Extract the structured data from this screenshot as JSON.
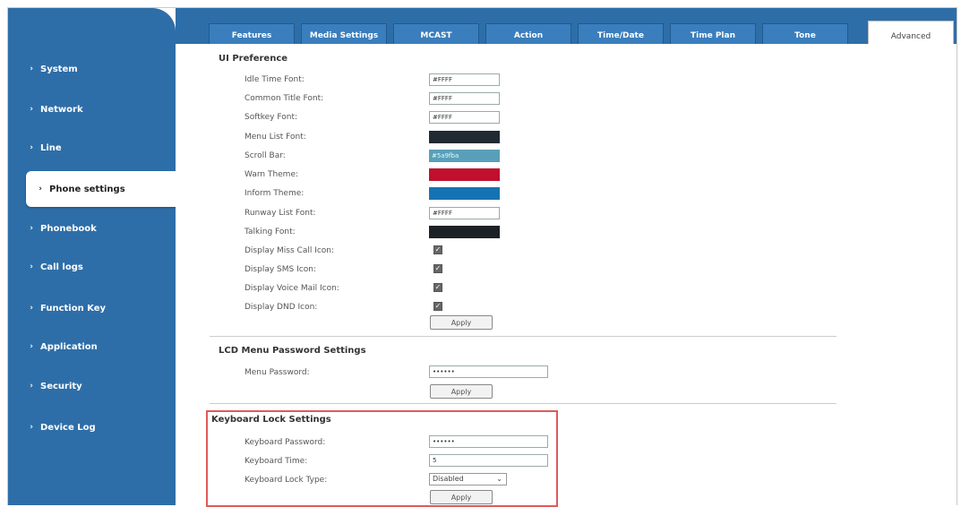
{
  "sidebar": {
    "items": [
      {
        "label": "System"
      },
      {
        "label": "Network"
      },
      {
        "label": "Line"
      },
      {
        "label": "Phone settings"
      },
      {
        "label": "Phonebook"
      },
      {
        "label": "Call logs"
      },
      {
        "label": "Function Key"
      },
      {
        "label": "Application"
      },
      {
        "label": "Security"
      },
      {
        "label": "Device Log"
      }
    ],
    "active": "Phone settings",
    "bullet": "›"
  },
  "tabs": [
    {
      "label": "Features"
    },
    {
      "label": "Media Settings"
    },
    {
      "label": "MCAST"
    },
    {
      "label": "Action"
    },
    {
      "label": "Time/Date"
    },
    {
      "label": "Time Plan"
    },
    {
      "label": "Tone"
    },
    {
      "label": "Advanced"
    }
  ],
  "active_tab": "Advanced",
  "ui_preference": {
    "title": "UI Preference",
    "rows": [
      {
        "label": "Idle Time Font:",
        "value": "#FFFF",
        "kind": "text"
      },
      {
        "label": "Common Title Font:",
        "value": "#FFFF",
        "kind": "text"
      },
      {
        "label": "Softkey Font:",
        "value": "#FFFF",
        "kind": "text"
      },
      {
        "label": "Menu List Font:",
        "value": "",
        "kind": "swatch",
        "color": "#1f2a33"
      },
      {
        "label": "Scroll Bar:",
        "value": "#5a9fba",
        "kind": "swatch",
        "color": "#5a9fba"
      },
      {
        "label": "Warn Theme:",
        "value": "",
        "kind": "swatch",
        "color": "#c0102e"
      },
      {
        "label": "Inform Theme:",
        "value": "",
        "kind": "swatch",
        "color": "#1673b3"
      },
      {
        "label": "Runway List Font:",
        "value": "#FFFF",
        "kind": "text"
      },
      {
        "label": "Talking Font:",
        "value": "",
        "kind": "swatch",
        "color": "#1c2126"
      }
    ],
    "checks": [
      {
        "label": "Display Miss Call Icon:",
        "checked": true
      },
      {
        "label": "Display SMS Icon:",
        "checked": true
      },
      {
        "label": "Display Voice Mail Icon:",
        "checked": true
      },
      {
        "label": "Display DND Icon:",
        "checked": true
      }
    ],
    "apply": "Apply"
  },
  "lcd": {
    "title": "LCD Menu Password Settings",
    "label": "Menu Password:",
    "value": "••••••",
    "apply": "Apply"
  },
  "keyboard": {
    "title": "Keyboard Lock Settings",
    "password_label": "Keyboard Password:",
    "password_value": "••••••",
    "time_label": "Keyboard Time:",
    "time_value": "5",
    "type_label": "Keyboard Lock Type:",
    "type_value": "Disabled",
    "apply": "Apply"
  },
  "colors": {
    "accent": "#2e6ea8",
    "highlight": "#e05a5a"
  }
}
